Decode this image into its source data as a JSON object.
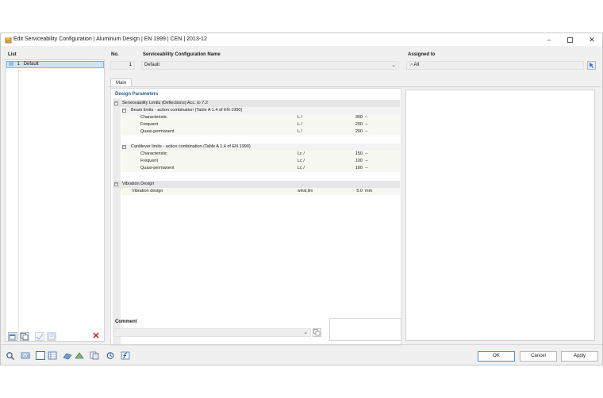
{
  "window": {
    "title": "Edit Serviceability Configuration | Aluminum Design | EN 1999 | CEN | 2013-12"
  },
  "list": {
    "label": "List",
    "items": [
      {
        "number": "1",
        "name": "Default"
      }
    ]
  },
  "header": {
    "no_label": "No.",
    "no_value": "1",
    "name_label": "Serviceability Configuration Name",
    "name_value": "Default",
    "assigned_label": "Assigned to",
    "assigned_value": "All"
  },
  "tabs": [
    {
      "label": "Main"
    }
  ],
  "design_parameters": {
    "title": "Design Parameters",
    "serviceability_limits": {
      "label": "Serviceability Limits (Deflections) Acc. to 7.2",
      "beam": {
        "label": "Beam limits - action combination (Table A 1.4 of EN 1990)",
        "rows": [
          {
            "name": "Characteristic",
            "symbol": "L /",
            "value": "300",
            "unit": "--"
          },
          {
            "name": "Frequent",
            "symbol": "L /",
            "value": "200",
            "unit": "--"
          },
          {
            "name": "Quasi-permanent",
            "symbol": "L /",
            "value": "200",
            "unit": "--"
          }
        ]
      },
      "cantilever": {
        "label": "Cantilever limits - action combination (Table A 1.4 of EN 1990)",
        "rows": [
          {
            "name": "Characteristic",
            "symbol": "Lc /",
            "value": "150",
            "unit": "--"
          },
          {
            "name": "Frequent",
            "symbol": "Lc /",
            "value": "100",
            "unit": "--"
          },
          {
            "name": "Quasi-permanent",
            "symbol": "Lc /",
            "value": "100",
            "unit": "--"
          }
        ]
      }
    },
    "vibration": {
      "label": "Vibration Design",
      "rows": [
        {
          "name": "Vibration design",
          "symbol": "winst,lim",
          "value": "5.0",
          "unit": "mm"
        }
      ]
    }
  },
  "comment": {
    "label": "Comment",
    "value": ""
  },
  "buttons": {
    "ok": "OK",
    "cancel": "Cancel",
    "apply": "Apply"
  },
  "colors": {
    "accent": "#2c5f8d",
    "selection": "#cde4f7",
    "delete": "#d42020"
  }
}
